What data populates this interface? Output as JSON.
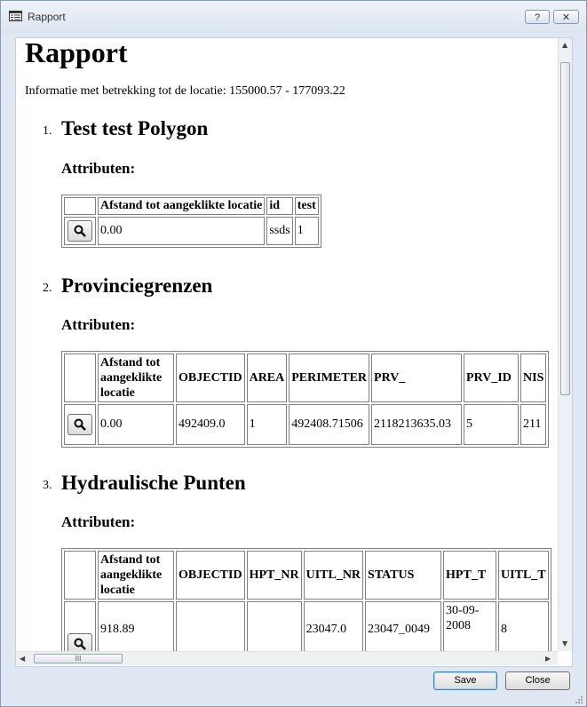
{
  "window": {
    "title": "Rapport",
    "help_label": "?",
    "close_label": "✕"
  },
  "report": {
    "heading": "Rapport",
    "info": "Informatie met betrekking tot de locatie: 155000.57 - 177093.22",
    "sections": [
      {
        "number": "1.",
        "title": "Test test Polygon",
        "sub": "Attributen:",
        "headers": [
          "Afstand tot aangeklikte locatie",
          "id",
          "test"
        ],
        "rows": [
          [
            "0.00",
            "ssds",
            "1"
          ]
        ]
      },
      {
        "number": "2.",
        "title": "Provinciegrenzen",
        "sub": "Attributen:",
        "headers": [
          "Afstand tot aangeklikte locatie",
          "OBJECTID",
          "AREA",
          "PERIMETER",
          "PRV_",
          "PRV_ID",
          "NIS"
        ],
        "rows": [
          [
            "0.00",
            "492409.0",
            "1",
            "492408.71506",
            "2118213635.03",
            "5",
            "211"
          ]
        ]
      },
      {
        "number": "3.",
        "title": "Hydraulische Punten",
        "sub": "Attributen:",
        "headers": [
          "Afstand tot aangeklikte locatie",
          "OBJECTID",
          "HPT_NR",
          "UITL_NR",
          "STATUS",
          "HPT_T",
          "UITL_T"
        ],
        "rows": [
          [
            "918.89",
            "",
            "",
            "23047.0",
            "23047_0049",
            "30-09-2008",
            "8"
          ]
        ]
      }
    ]
  },
  "scrollbar": {
    "h_thumb_label": "III"
  },
  "buttons": {
    "save": "Save",
    "close": "Close"
  },
  "icons": {
    "zoom": "magnifier-icon",
    "app": "report-window-icon"
  }
}
